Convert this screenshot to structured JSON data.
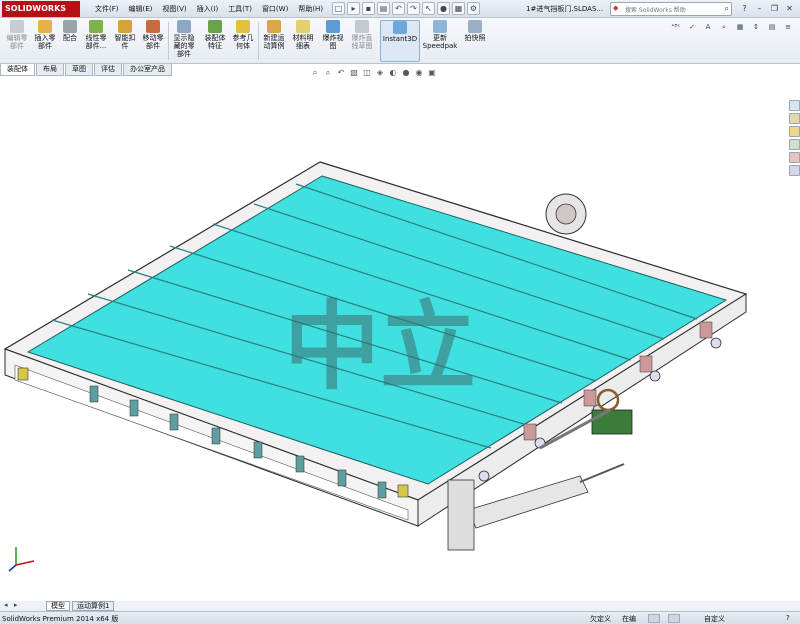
{
  "titlebar": {
    "app_logo": "SOLIDWORKS",
    "menu": [
      "文件(F)",
      "编辑(E)",
      "视图(V)",
      "插入(I)",
      "工具(T)",
      "窗口(W)",
      "帮助(H)"
    ],
    "document_title": "1#进气挡板门.SLDAS...",
    "search_placeholder": "搜索 SolidWorks 帮助"
  },
  "ribbon": {
    "buttons": [
      {
        "label": "编辑零\n部件",
        "icon": "edit-component-icon",
        "enabled": false
      },
      {
        "label": "插入零\n部件",
        "icon": "insert-component-icon",
        "enabled": true
      },
      {
        "label": "配合",
        "icon": "mate-icon",
        "enabled": true
      },
      {
        "label": "线性零\n部件...",
        "icon": "linear-pattern-icon",
        "enabled": true
      },
      {
        "label": "智能扣\n件",
        "icon": "smart-fasteners-icon",
        "enabled": true
      },
      {
        "label": "移动零\n部件",
        "icon": "move-component-icon",
        "enabled": true
      },
      {
        "label": "显示隐\n藏的零\n部件",
        "icon": "show-hidden-icon",
        "enabled": true
      },
      {
        "label": "装配体\n特征",
        "icon": "assembly-features-icon",
        "enabled": true
      },
      {
        "label": "参考几\n何体",
        "icon": "reference-geometry-icon",
        "enabled": true
      },
      {
        "label": "新建运\n动算例",
        "icon": "new-motion-study-icon",
        "enabled": true
      },
      {
        "label": "材料明\n细表",
        "icon": "bill-of-materials-icon",
        "enabled": true
      },
      {
        "label": "爆炸视\n图",
        "icon": "exploded-view-icon",
        "enabled": true
      },
      {
        "label": "爆炸直\n线草图",
        "icon": "explode-line-sketch-icon",
        "enabled": false
      },
      {
        "label": "Instant3D",
        "icon": "instant3d-icon",
        "enabled": true
      },
      {
        "label": "更新\nSpeedpak",
        "icon": "speedpak-icon",
        "enabled": true
      },
      {
        "label": "拍快照",
        "icon": "snapshot-icon",
        "enabled": true
      }
    ]
  },
  "tabs": [
    "装配体",
    "布局",
    "草图",
    "评估",
    "办公室产品"
  ],
  "bottom_tabs": [
    "模型",
    "运动算例1"
  ],
  "status": {
    "app_version": "SolidWorks Premium 2014 x64 版",
    "under_defined": "欠定义",
    "editing": "在编",
    "custom": "自定义"
  },
  "watermark": "中立",
  "colors": {
    "brand": "#b80f16",
    "panel_fill": "#40e0e0",
    "frame": "#f2f0f0",
    "outline": "#2b2b2b"
  }
}
